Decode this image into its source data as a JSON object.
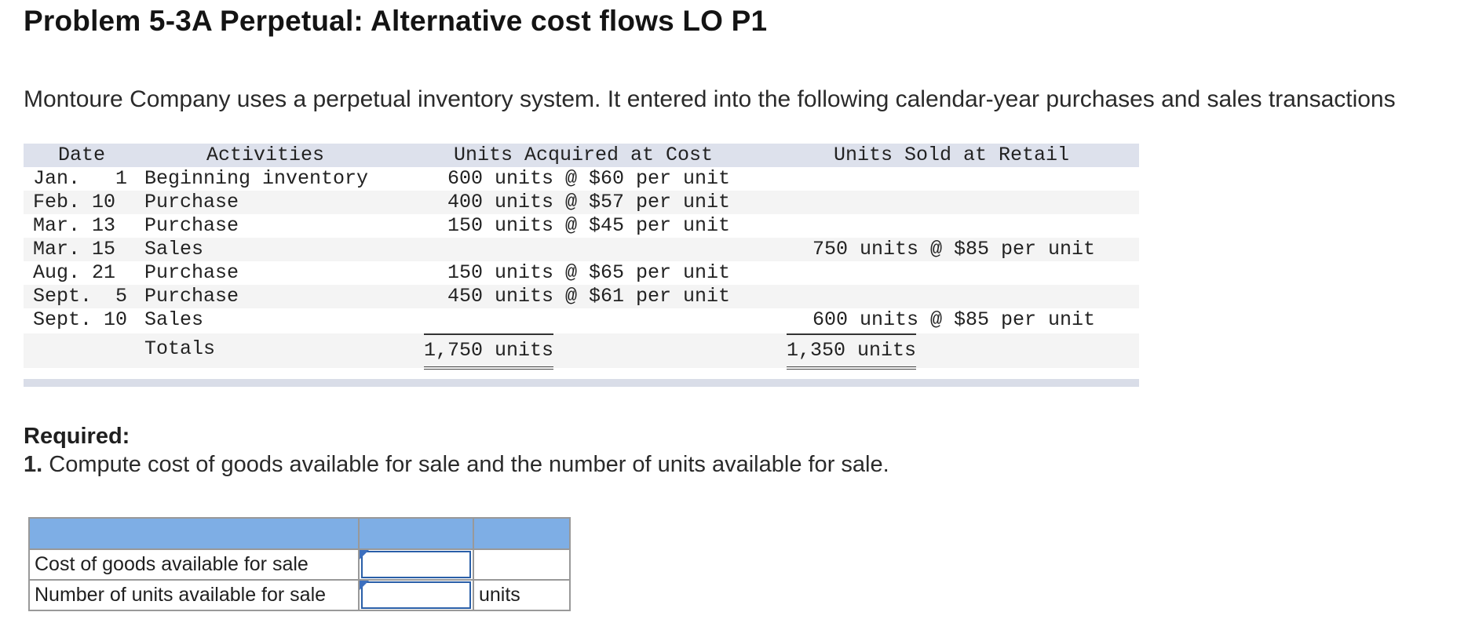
{
  "title": "Problem 5-3A Perpetual: Alternative cost flows LO P1",
  "intro": "Montoure Company uses a perpetual inventory system. It entered into the following calendar-year purchases and sales transactions",
  "table": {
    "headers": [
      "Date",
      "Activities",
      "Units Acquired at Cost",
      "Units Sold at Retail"
    ],
    "rows": [
      {
        "date": "Jan.   1",
        "activity": "Beginning inventory",
        "acquired": "600 units @ $60 per unit",
        "sold": ""
      },
      {
        "date": "Feb. 10",
        "activity": "Purchase",
        "acquired": "400 units @ $57 per unit",
        "sold": ""
      },
      {
        "date": "Mar. 13",
        "activity": "Purchase",
        "acquired": "150 units @ $45 per unit",
        "sold": ""
      },
      {
        "date": "Mar. 15",
        "activity": "Sales",
        "acquired": "",
        "sold": "750 units @ $85 per unit"
      },
      {
        "date": "Aug. 21",
        "activity": "Purchase",
        "acquired": "150 units @ $65 per unit",
        "sold": ""
      },
      {
        "date": "Sept.  5",
        "activity": "Purchase",
        "acquired": "450 units @ $61 per unit",
        "sold": ""
      },
      {
        "date": "Sept. 10",
        "activity": "Sales",
        "acquired": "",
        "sold": "600 units @ $85 per unit"
      }
    ],
    "totals": {
      "label": "Totals",
      "acquired": "1,750 units",
      "sold": "1,350 units"
    }
  },
  "required_label": "Required:",
  "question_number": "1.",
  "question_text": "Compute cost of goods available for sale and the number of units available for sale.",
  "answer": {
    "rows": [
      {
        "label": "Cost of goods available for sale",
        "value": "",
        "unit": ""
      },
      {
        "label": "Number of units available for sale",
        "value": "",
        "unit": "units"
      }
    ]
  },
  "colors": {
    "header_band": "#dde1ec",
    "answer_header": "#7eaee5",
    "input_border": "#2a5fa8"
  }
}
